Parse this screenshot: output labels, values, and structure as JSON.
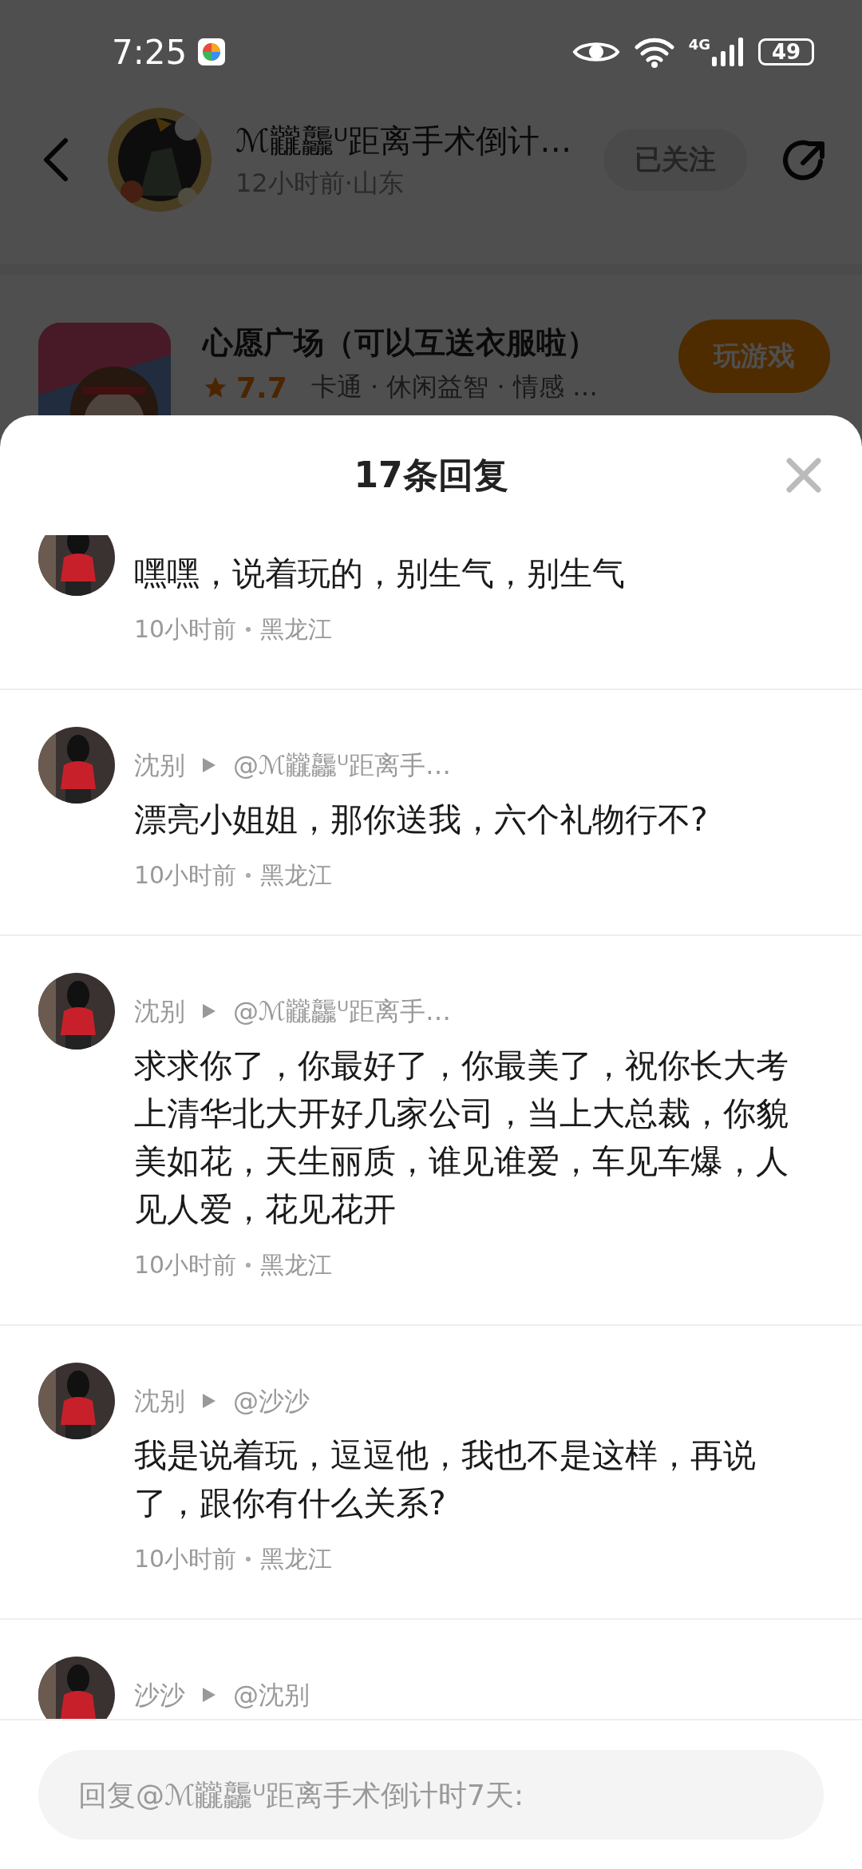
{
  "status_bar": {
    "time": "7:25",
    "network": "4G",
    "battery": "49"
  },
  "post_header": {
    "author": "ℳ龖龘ᵁ距离手术倒计…",
    "meta": "12小时前·山东",
    "follow_button": "已关注"
  },
  "app_card": {
    "title": "心愿广场（可以互送衣服啦）",
    "rating": "7.7",
    "tags": "卡通 · 休闲益智 · 情感 …",
    "button": "玩游戏"
  },
  "replies_sheet": {
    "title": "17条回复",
    "comments": [
      {
        "text": "嘿嘿，说着玩的，别生气，别生气",
        "time": "10小时前",
        "location": "黑龙江"
      },
      {
        "author": "沈别",
        "reply_to": "@ℳ龖龘ᵁ距离手…",
        "text": "漂亮小姐姐，那你送我，六个礼物行不?",
        "time": "10小时前",
        "location": "黑龙江"
      },
      {
        "author": "沈别",
        "reply_to": "@ℳ龖龘ᵁ距离手…",
        "text": "求求你了，你最好了，你最美了，祝你长大考上清华北大开好几家公司，当上大总裁，你貌美如花，天生丽质，谁见谁爱，车见车爆，人见人爱，花见花开",
        "time": "10小时前",
        "location": "黑龙江"
      },
      {
        "author": "沈别",
        "reply_to": "@沙沙",
        "text": "我是说着玩，逗逗他，我也不是这样，再说了，跟你有什么关系?",
        "time": "10小时前",
        "location": "黑龙江"
      },
      {
        "author": "沙沙",
        "reply_to": "@沈别"
      }
    ],
    "reply_box": {
      "placeholder": "回复@ℳ龖龘ᵁ距离手术倒计时7天:"
    }
  }
}
